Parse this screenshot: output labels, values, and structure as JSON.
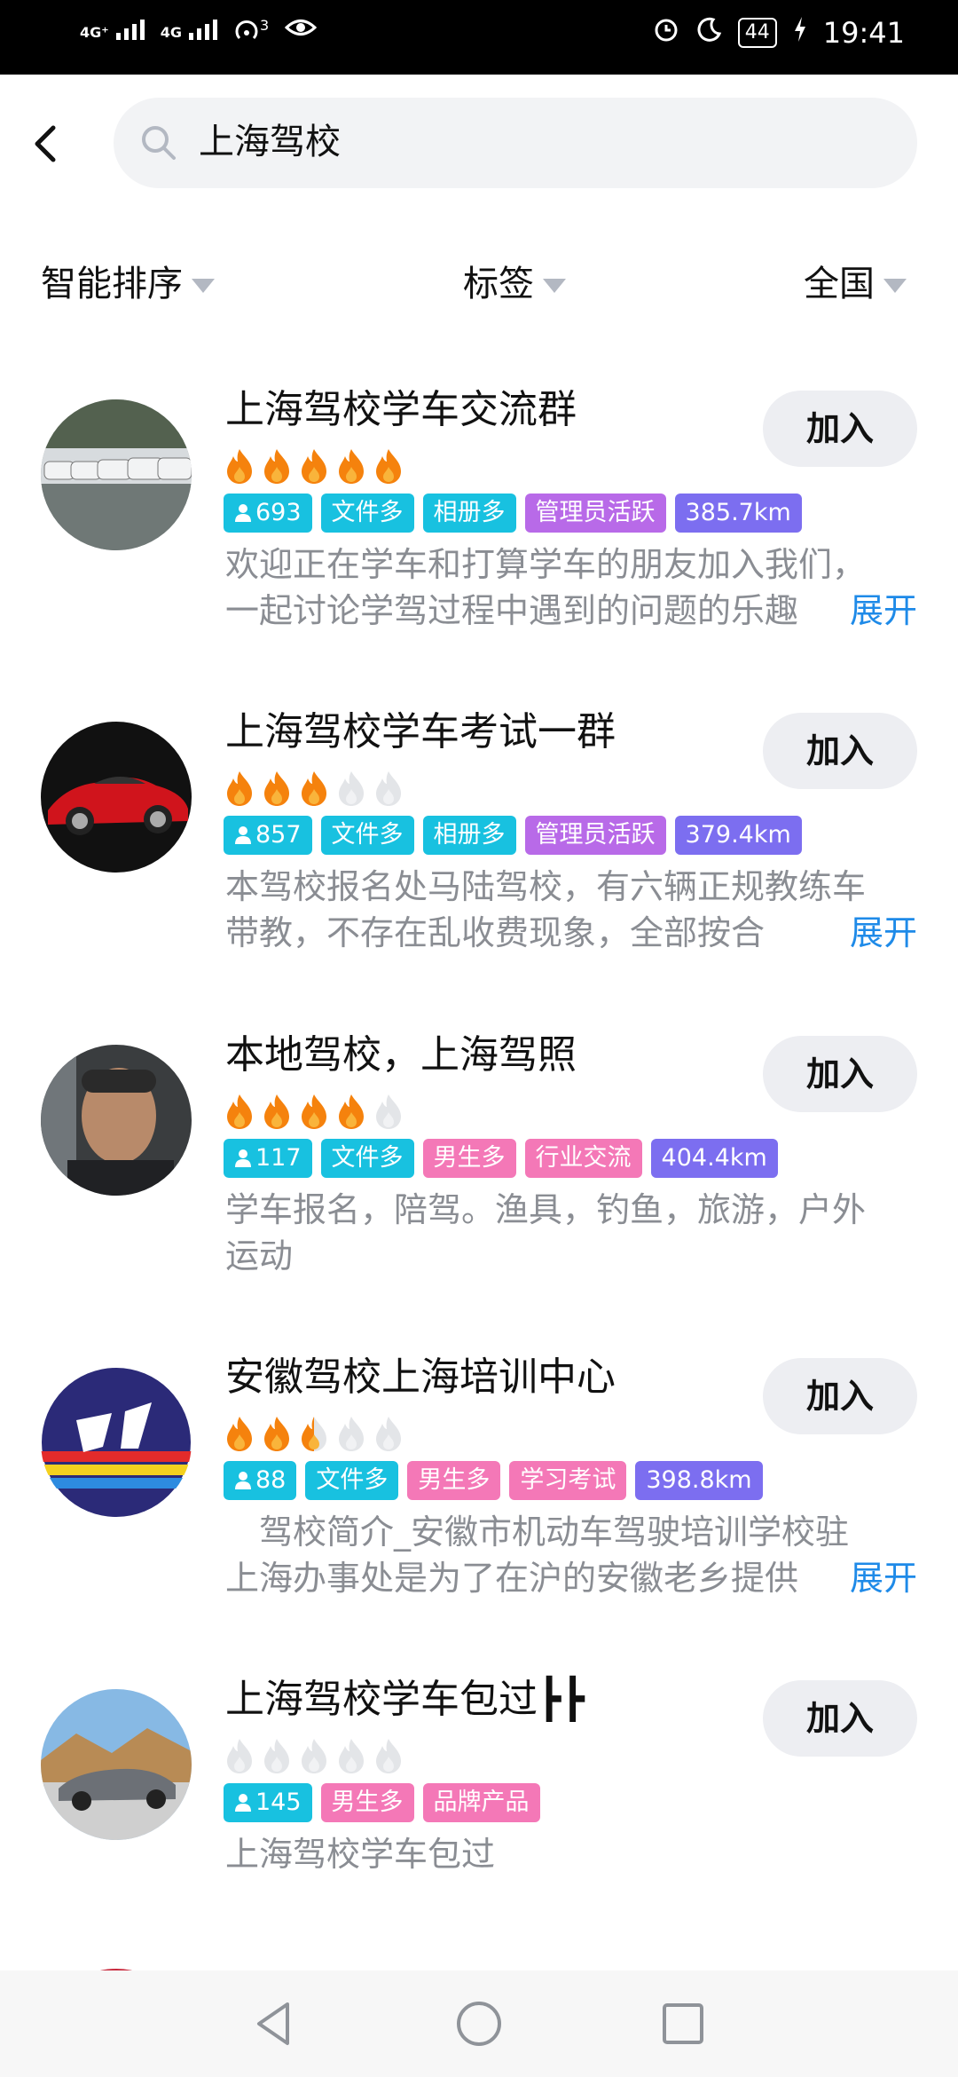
{
  "status_bar": {
    "net1": "4G⁺",
    "net2": "4G",
    "hotspot_count": "3",
    "battery": "44",
    "time": "19:41"
  },
  "search": {
    "query": "上海驾校"
  },
  "filters": {
    "sort": "智能排序",
    "tags": "标签",
    "region": "全国"
  },
  "groups": [
    {
      "title": "上海驾校学车交流群",
      "rating": 5,
      "members": "693",
      "tags": [
        {
          "text": "文件多",
          "color": "cyan"
        },
        {
          "text": "相册多",
          "color": "cyan"
        },
        {
          "text": "管理员活跃",
          "color": "purple"
        },
        {
          "text": "385.7km",
          "color": "indigo"
        }
      ],
      "desc": [
        "欢迎正在学车和打算学车的朋友加入我们，",
        "一起讨论学驾过程中遇到的问题的乐趣"
      ],
      "expand": "展开",
      "join": "加入"
    },
    {
      "title": "上海驾校学车考试一群",
      "rating": 3,
      "members": "857",
      "tags": [
        {
          "text": "文件多",
          "color": "cyan"
        },
        {
          "text": "相册多",
          "color": "cyan"
        },
        {
          "text": "管理员活跃",
          "color": "purple"
        },
        {
          "text": "379.4km",
          "color": "indigo"
        }
      ],
      "desc": [
        "本驾校报名处马陆驾校，有六辆正规教练车",
        "带教，不存在乱收费现象，全部按合"
      ],
      "expand": "展开",
      "join": "加入"
    },
    {
      "title": "本地驾校，上海驾照",
      "rating": 4,
      "members": "117",
      "tags": [
        {
          "text": "文件多",
          "color": "cyan"
        },
        {
          "text": "男生多",
          "color": "pink"
        },
        {
          "text": "行业交流",
          "color": "pink"
        },
        {
          "text": "404.4km",
          "color": "indigo"
        }
      ],
      "desc": [
        "学车报名，陪驾。渔具，钓鱼，旅游，户外",
        "运动"
      ],
      "expand": "",
      "join": "加入"
    },
    {
      "title": "安徽驾校上海培训中心",
      "rating": 2.5,
      "members": "88",
      "tags": [
        {
          "text": "文件多",
          "color": "cyan"
        },
        {
          "text": "男生多",
          "color": "pink"
        },
        {
          "text": "学习考试",
          "color": "pink"
        },
        {
          "text": "398.8km",
          "color": "indigo"
        }
      ],
      "desc": [
        "　驾校简介_安徽市机动车驾驶培训学校驻",
        "上海办事处是为了在沪的安徽老乡提供"
      ],
      "expand": "展开",
      "join": "加入"
    },
    {
      "title": "上海驾校学车包过┣┣",
      "rating": 0,
      "members": "145",
      "tags": [
        {
          "text": "男生多",
          "color": "pink"
        },
        {
          "text": "品牌产品",
          "color": "pink"
        }
      ],
      "desc": [
        "上海驾校学车包过"
      ],
      "expand": "",
      "join": "加入"
    }
  ]
}
